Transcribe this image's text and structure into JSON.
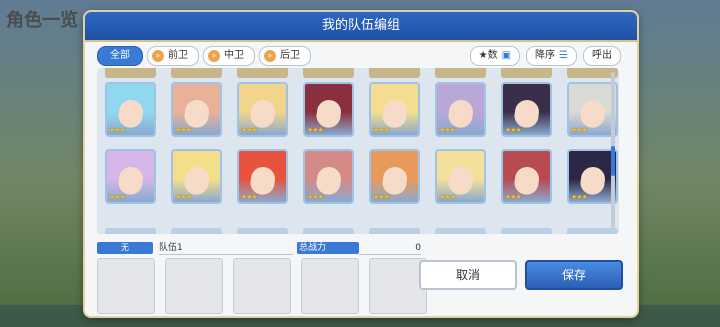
{
  "background": {
    "title": "角色一览"
  },
  "dialog": {
    "title": "我的队伍编组",
    "tabs": [
      {
        "label": "全部",
        "icon": ""
      },
      {
        "label": "前卫",
        "icon": "vanguard-icon"
      },
      {
        "label": "中卫",
        "icon": "midguard-icon"
      },
      {
        "label": "后卫",
        "icon": "rearguard-icon"
      }
    ],
    "sort_field": "★数",
    "sort_order": "降序",
    "recall": "呼出",
    "team_label": "无",
    "team_name": "队伍1",
    "power_label": "总战力",
    "power_value": "0",
    "cancel": "取消",
    "save": "保存"
  },
  "characters": [
    {
      "stars": "★★★",
      "hair": "#8fd8f0"
    },
    {
      "stars": "★★★",
      "hair": "#e9b19a"
    },
    {
      "stars": "★★★",
      "hair": "#f2d58c"
    },
    {
      "stars": "★★★",
      "hair": "#8a2f3d"
    },
    {
      "stars": "★★★",
      "hair": "#f4dd8f"
    },
    {
      "stars": "★★★",
      "hair": "#b9a7d8"
    },
    {
      "stars": "★★★",
      "hair": "#3a2f4a"
    },
    {
      "stars": "★★★",
      "hair": "#d9d9d6"
    },
    {
      "stars": "★★★",
      "hair": "#d4b7e8"
    },
    {
      "stars": "★★★",
      "hair": "#f3df8a"
    },
    {
      "stars": "★★★",
      "hair": "#e8533f"
    },
    {
      "stars": "★★★",
      "hair": "#d48a86"
    },
    {
      "stars": "★★★",
      "hair": "#e89a5a"
    },
    {
      "stars": "★★★",
      "hair": "#f4e09b"
    },
    {
      "stars": "★★★",
      "hair": "#b84a52"
    },
    {
      "stars": "★★★",
      "hair": "#2c2744"
    }
  ]
}
